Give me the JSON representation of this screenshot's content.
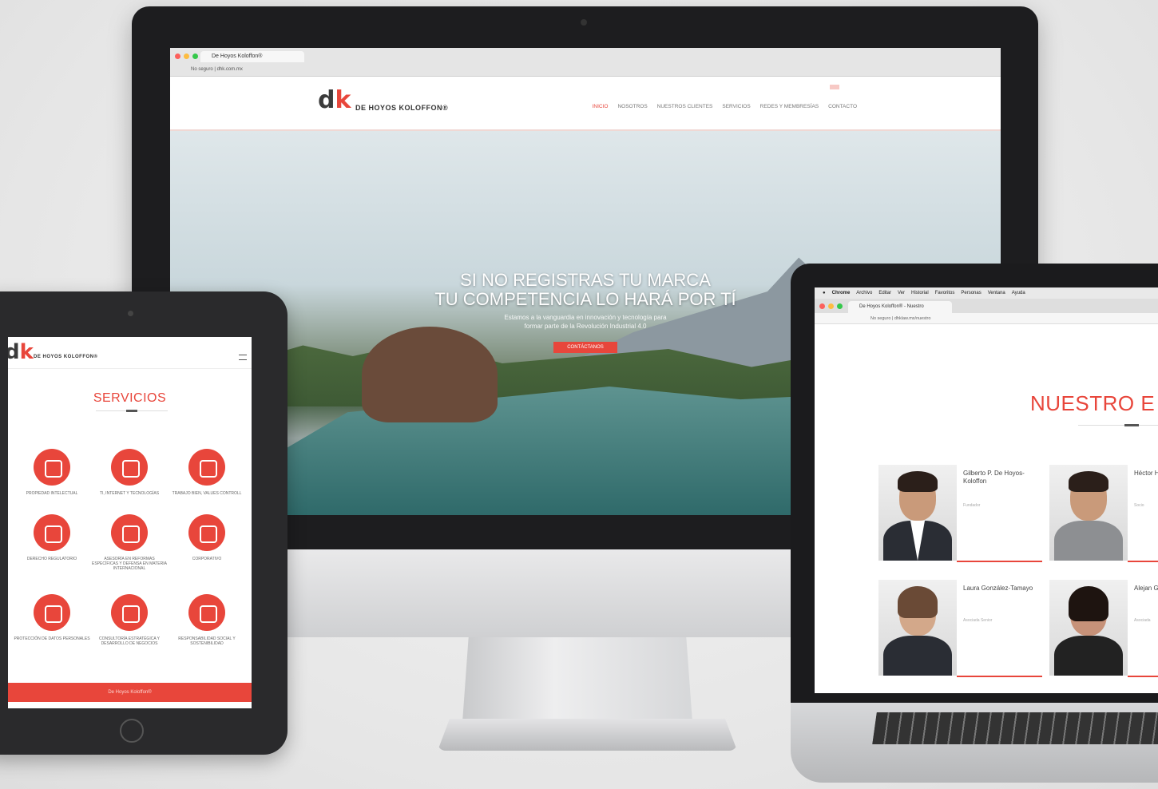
{
  "imac": {
    "tab_title": "De Hoyos Koloffon®",
    "address": "No seguro | dhk.com.mx",
    "logo_text": "DE HOYOS KOLOFFON®",
    "menu": [
      "INICIO",
      "NOSOTROS",
      "NUESTROS CLIENTES",
      "SERVICIOS",
      "REDES Y MEMBRESÍAS",
      "CONTACTO"
    ],
    "hero_title_1": "SI NO REGISTRAS TU MARCA",
    "hero_title_2": "TU COMPETENCIA LO HARÁ POR TÍ",
    "hero_sub_1": "Estamos a la vanguardia en innovación y tecnología para",
    "hero_sub_2": "formar parte de la Revolución Industrial 4.0",
    "hero_button": "CONTÁCTANOS"
  },
  "ipad": {
    "logo_text": "DE HOYOS KOLOFFON®",
    "title": "SERVICIOS",
    "services": [
      {
        "label": "PROPIEDAD INTELECTUAL",
        "icon": "gears-icon"
      },
      {
        "label": "TI, INTERNET Y TECNOLOGÍAS",
        "icon": "monitor-icon"
      },
      {
        "label": "TRABAJO BIEN, VALUES CONTROLL",
        "icon": "settings-icon"
      },
      {
        "label": "DERECHO REGULATORIO",
        "icon": "building-icon"
      },
      {
        "label": "ASESORÍA EN REFORMAS ESPECÍFICAS Y DEFENSA EN MATERIA INTERNACIONAL",
        "icon": "globe-icon"
      },
      {
        "label": "CORPORATIVO",
        "icon": "document-icon"
      },
      {
        "label": "PROTECCIÓN DE DATOS PERSONALES",
        "icon": "laptop-icon"
      },
      {
        "label": "CONSULTORÍA ESTRATÉGICA Y DESARROLLO DE NEGOCIOS",
        "icon": "phone-icon"
      },
      {
        "label": "RESPONSABILIDAD SOCIAL Y SOSTENIBILIDAD",
        "icon": "puzzle-icon"
      }
    ],
    "footer": "De Hoyos Koloffon®"
  },
  "macbook": {
    "menu": [
      "Chrome",
      "Archivo",
      "Editar",
      "Ver",
      "Historial",
      "Favoritos",
      "Personas",
      "Ventana",
      "Ayuda"
    ],
    "tab_title": "De Hoyos Koloffon® - Nuestro",
    "address": "No seguro | dhklaw.mx/nuestro",
    "heading": "NUESTRO E",
    "team": [
      {
        "name": "Gilberto P. De Hoyos-Koloffon",
        "role": "Fundador"
      },
      {
        "name": "Héctor Hoyos",
        "role": "Socio"
      },
      {
        "name": "Laura González-Tamayo",
        "role": "Asociada Senior"
      },
      {
        "name": "Alejan Garza-",
        "role": "Asociada"
      }
    ]
  },
  "colors": {
    "accent": "#e8463b",
    "bezel": "#1d1d1f"
  }
}
